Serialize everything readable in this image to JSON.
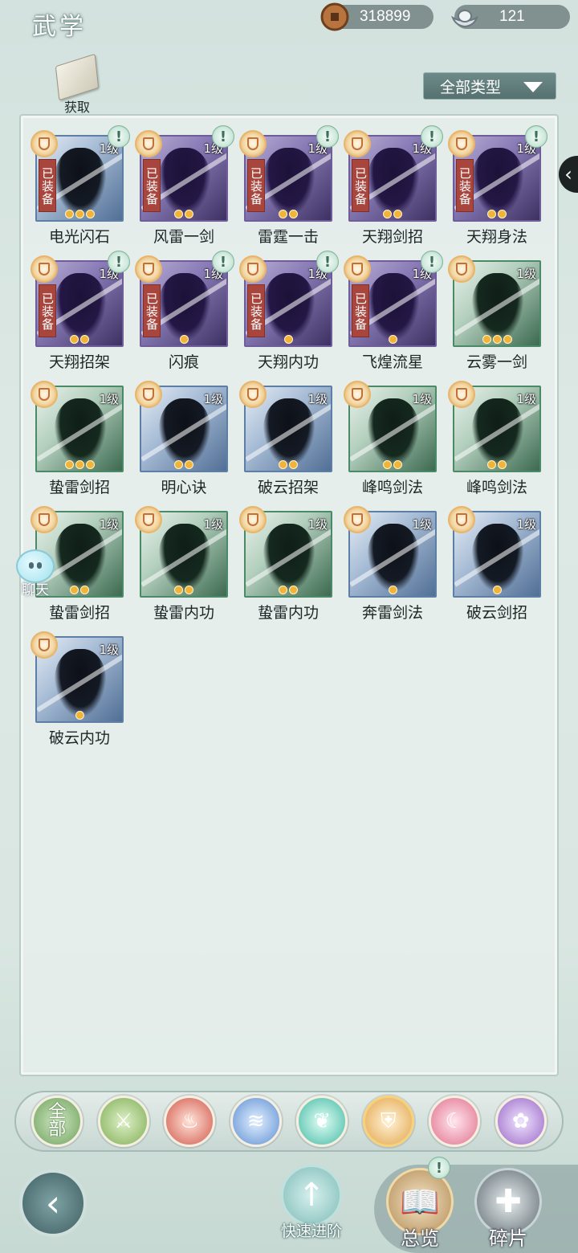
{
  "header": {
    "title": "武学",
    "copper": "318899",
    "silver": "121",
    "get_label": "获取",
    "filter_label": "全部类型"
  },
  "cards": [
    {
      "name": "电光闪石",
      "level": "1级",
      "equipped": true,
      "stars": 3,
      "alert": true,
      "tone": "blue"
    },
    {
      "name": "风雷一剑",
      "level": "1级",
      "equipped": true,
      "stars": 2,
      "alert": true,
      "tone": "purple"
    },
    {
      "name": "雷霆一击",
      "level": "1级",
      "equipped": true,
      "stars": 2,
      "alert": true,
      "tone": "purple"
    },
    {
      "name": "天翔剑招",
      "level": "1级",
      "equipped": true,
      "stars": 2,
      "alert": true,
      "tone": "purple"
    },
    {
      "name": "天翔身法",
      "level": "1级",
      "equipped": true,
      "stars": 2,
      "alert": true,
      "tone": "purple"
    },
    {
      "name": "天翔招架",
      "level": "1级",
      "equipped": true,
      "stars": 2,
      "alert": true,
      "tone": "purple"
    },
    {
      "name": "闪痕",
      "level": "1级",
      "equipped": true,
      "stars": 1,
      "alert": true,
      "tone": "purple"
    },
    {
      "name": "天翔内功",
      "level": "1级",
      "equipped": true,
      "stars": 1,
      "alert": true,
      "tone": "purple"
    },
    {
      "name": "飞煌流星",
      "level": "1级",
      "equipped": true,
      "stars": 1,
      "alert": true,
      "tone": "purple"
    },
    {
      "name": "云雾一剑",
      "level": "1级",
      "equipped": false,
      "stars": 3,
      "alert": false,
      "tone": "green"
    },
    {
      "name": "蛰雷剑招",
      "level": "1级",
      "equipped": false,
      "stars": 3,
      "alert": false,
      "tone": "green"
    },
    {
      "name": "明心诀",
      "level": "1级",
      "equipped": false,
      "stars": 2,
      "alert": false,
      "tone": "blue"
    },
    {
      "name": "破云招架",
      "level": "1级",
      "equipped": false,
      "stars": 2,
      "alert": false,
      "tone": "blue"
    },
    {
      "name": "峰鸣剑法",
      "level": "1级",
      "equipped": false,
      "stars": 2,
      "alert": false,
      "tone": "green"
    },
    {
      "name": "峰鸣剑法",
      "level": "1级",
      "equipped": false,
      "stars": 2,
      "alert": false,
      "tone": "green"
    },
    {
      "name": "蛰雷剑招",
      "level": "1级",
      "equipped": false,
      "stars": 2,
      "alert": false,
      "tone": "green"
    },
    {
      "name": "蛰雷内功",
      "level": "1级",
      "equipped": false,
      "stars": 2,
      "alert": false,
      "tone": "green"
    },
    {
      "name": "蛰雷内功",
      "level": "1级",
      "equipped": false,
      "stars": 2,
      "alert": false,
      "tone": "green"
    },
    {
      "name": "奔雷剑法",
      "level": "1级",
      "equipped": false,
      "stars": 1,
      "alert": false,
      "tone": "blue"
    },
    {
      "name": "破云剑招",
      "level": "1级",
      "equipped": false,
      "stars": 1,
      "alert": false,
      "tone": "blue"
    },
    {
      "name": "破云内功",
      "level": "1级",
      "equipped": false,
      "stars": 1,
      "alert": false,
      "tone": "blue"
    }
  ],
  "equipped_label": "已装备",
  "chat_label": "聊天",
  "categories": {
    "all_label_1": "全",
    "all_label_2": "部",
    "icons": [
      "sword-icon",
      "flame-icon",
      "wave-icon",
      "butterfly-icon",
      "shield-icon",
      "moon-icon",
      "flower-icon"
    ]
  },
  "bottom": {
    "quick_label": "快速进阶",
    "overview_label": "总览",
    "fragments_label": "碎片"
  }
}
